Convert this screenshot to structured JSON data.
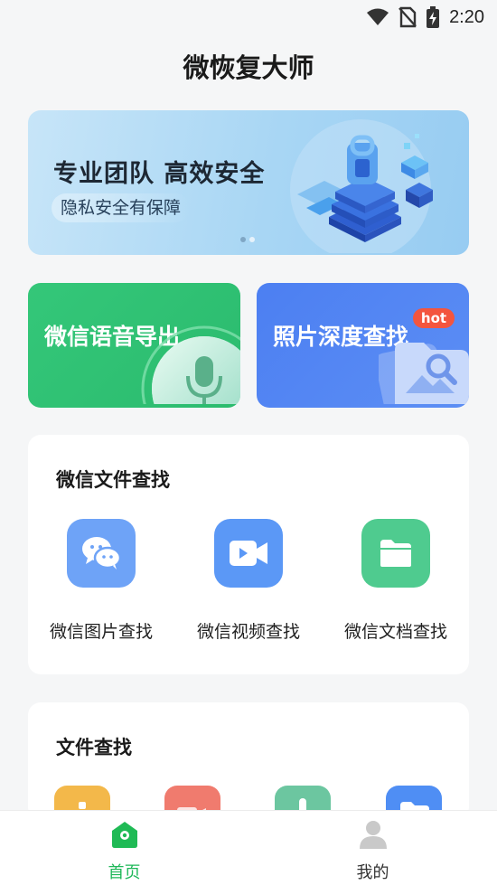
{
  "status_bar": {
    "time": "2:20"
  },
  "header": {
    "title": "微恢复大师"
  },
  "banner": {
    "title": "专业团队  高效安全",
    "subtitle": "隐私安全有保障",
    "active_slide": 1,
    "slide_count": 2
  },
  "features": [
    {
      "label": "微信语音导出",
      "color": "#2fc172"
    },
    {
      "label": "照片深度查找",
      "color": "#4f82f3",
      "badge": "hot"
    }
  ],
  "wechat_search": {
    "title": "微信文件查找",
    "items": [
      {
        "label": "微信图片查找",
        "icon": "wechat-chat-icon",
        "color": "#6ea3f7"
      },
      {
        "label": "微信视频查找",
        "icon": "video-camera-icon",
        "color": "#5b98f6"
      },
      {
        "label": "微信文档查找",
        "icon": "folder-icon",
        "color": "#4fcb8f"
      }
    ]
  },
  "file_search": {
    "title": "文件查找",
    "items": [
      {
        "icon": "image-file-icon",
        "color": "#f3b84a"
      },
      {
        "icon": "video-file-icon",
        "color": "#f07b6e"
      },
      {
        "icon": "audio-file-icon",
        "color": "#6cc6a0"
      },
      {
        "icon": "folder-file-icon",
        "color": "#4f8ef4"
      }
    ]
  },
  "bottom_nav": [
    {
      "label": "首页",
      "active": true
    },
    {
      "label": "我的",
      "active": false
    }
  ]
}
